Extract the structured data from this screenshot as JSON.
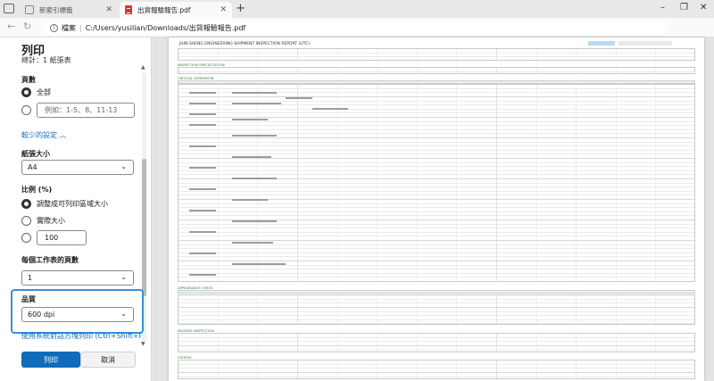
{
  "browser": {
    "tabs": [
      {
        "label": "新索引標籤",
        "active": false
      },
      {
        "label": "出貨報驗報告.pdf",
        "active": true
      }
    ],
    "address": {
      "info_label": "檔案",
      "path": "C:/Users/yusilian/Downloads/出貨報驗報告.pdf"
    },
    "window_controls": [
      "–",
      "❐",
      "✕"
    ]
  },
  "print_panel": {
    "title": "列印",
    "subtitle": "總計：1 紙張表",
    "pages": {
      "label": "頁數",
      "option_all": "全部",
      "custom_placeholder": "例如：1-5、8、11-13"
    },
    "fewer_settings": "較少的設定 ︿",
    "paper_size": {
      "label": "紙張大小",
      "value": "A4"
    },
    "scale": {
      "label": "比例 (%)",
      "option_fit": "調整成可列印區域大小",
      "option_actual": "實際大小",
      "custom_value": "100"
    },
    "pages_per_sheet": {
      "label": "每個工作表的頁數",
      "value": "1"
    },
    "quality": {
      "label": "品質",
      "value": "600 dpi"
    },
    "system_dialog_link": "使用系統對話方塊列印 (Ctrl+Shift+P)",
    "print_button": "列印",
    "cancel_button": "取消"
  },
  "document": {
    "title": "JIUN-SHENG ENGINEERING SHIPMENT INSPECTION REPORT (UTC)",
    "heading_1": "INSPECTION SPECIFICATION",
    "heading_2": "CRITICAL DIMENSION",
    "heading_3": "APPEARANCE CHECK",
    "heading_4": "PACKING INSPECTION",
    "heading_5": "OTHERS"
  },
  "colors": {
    "accent": "#0f6cbd",
    "focus_border": "#3b8ed8",
    "pdf_icon": "#dd3333"
  }
}
